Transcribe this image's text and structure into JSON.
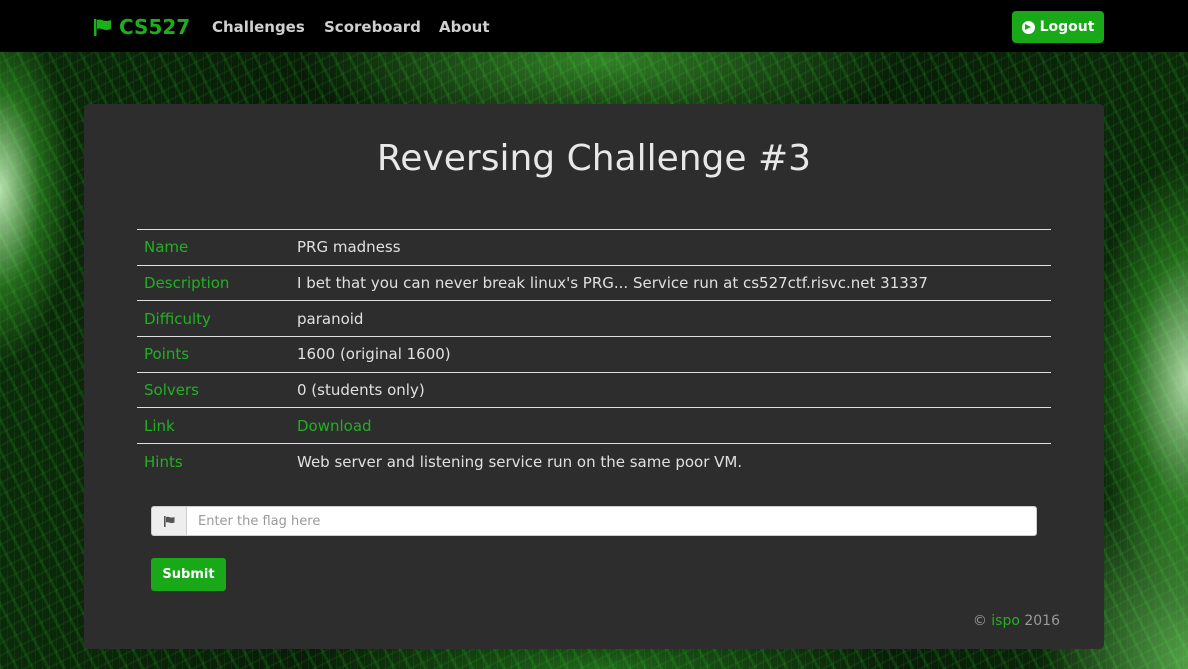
{
  "nav": {
    "brand": "CS527",
    "brand_icon": "flag-icon",
    "links": [
      "Challenges",
      "Scoreboard",
      "About"
    ],
    "logout_label": "Logout",
    "logout_icon": "arrow-circle-right-icon"
  },
  "challenge": {
    "title": "Reversing Challenge #3",
    "rows": [
      {
        "label": "Name",
        "value": "PRG madness"
      },
      {
        "label": "Description",
        "value": "I bet that you can never break linux's PRG... Service run at cs527ctf.risvc.net 31337"
      },
      {
        "label": "Difficulty",
        "value": "paranoid"
      },
      {
        "label": "Points",
        "value": "1600 (original 1600)"
      },
      {
        "label": "Solvers",
        "value": "0 (students only)"
      },
      {
        "label": "Link",
        "value": "Download"
      },
      {
        "label": "Hints",
        "value": "Web server and listening service run on the same poor VM."
      }
    ]
  },
  "flag_form": {
    "placeholder": "Enter the flag here",
    "value": "",
    "submit_label": "Submit"
  },
  "footer": {
    "copyright": "©",
    "author": "ispo",
    "year": "2016"
  },
  "colors": {
    "accent": "#18a818",
    "panel": "#2d2d2d",
    "navbar": "#000000"
  }
}
